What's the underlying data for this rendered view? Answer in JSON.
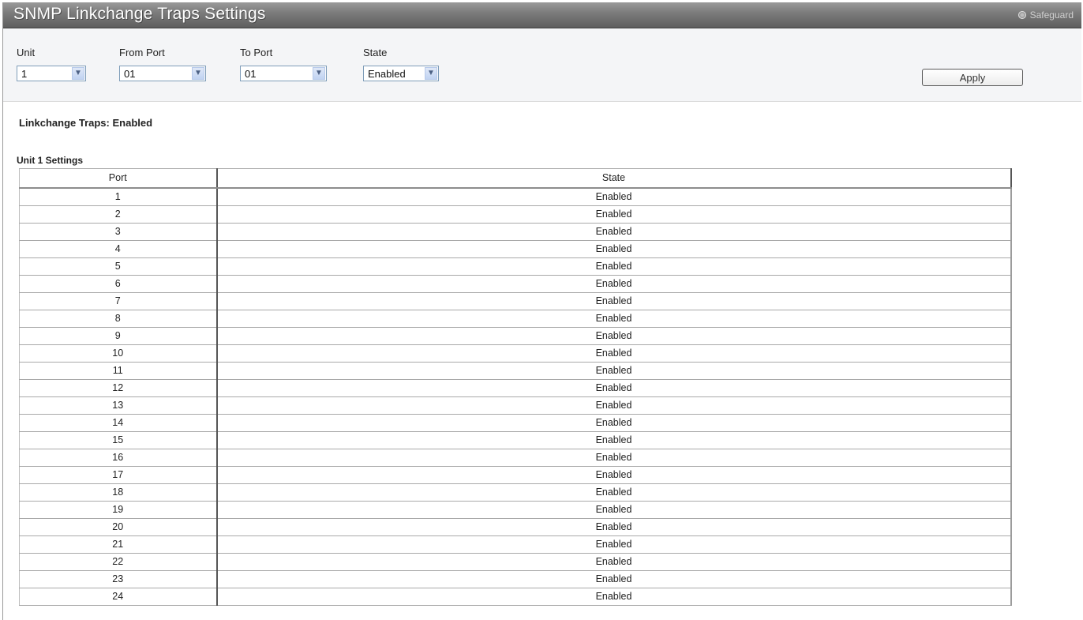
{
  "header": {
    "title": "SNMP Linkchange Traps Settings",
    "safeguard_label": "Safeguard"
  },
  "form": {
    "unit": {
      "label": "Unit",
      "value": "1"
    },
    "from_port": {
      "label": "From Port",
      "value": "01"
    },
    "to_port": {
      "label": "To Port",
      "value": "01"
    },
    "state": {
      "label": "State",
      "value": "Enabled"
    },
    "apply_label": "Apply"
  },
  "status": {
    "text": "Linkchange Traps: Enabled"
  },
  "table": {
    "title": "Unit 1 Settings",
    "columns": [
      "Port",
      "State"
    ],
    "rows": [
      [
        "1",
        "Enabled"
      ],
      [
        "2",
        "Enabled"
      ],
      [
        "3",
        "Enabled"
      ],
      [
        "4",
        "Enabled"
      ],
      [
        "5",
        "Enabled"
      ],
      [
        "6",
        "Enabled"
      ],
      [
        "7",
        "Enabled"
      ],
      [
        "8",
        "Enabled"
      ],
      [
        "9",
        "Enabled"
      ],
      [
        "10",
        "Enabled"
      ],
      [
        "11",
        "Enabled"
      ],
      [
        "12",
        "Enabled"
      ],
      [
        "13",
        "Enabled"
      ],
      [
        "14",
        "Enabled"
      ],
      [
        "15",
        "Enabled"
      ],
      [
        "16",
        "Enabled"
      ],
      [
        "17",
        "Enabled"
      ],
      [
        "18",
        "Enabled"
      ],
      [
        "19",
        "Enabled"
      ],
      [
        "20",
        "Enabled"
      ],
      [
        "21",
        "Enabled"
      ],
      [
        "22",
        "Enabled"
      ],
      [
        "23",
        "Enabled"
      ],
      [
        "24",
        "Enabled"
      ]
    ]
  }
}
